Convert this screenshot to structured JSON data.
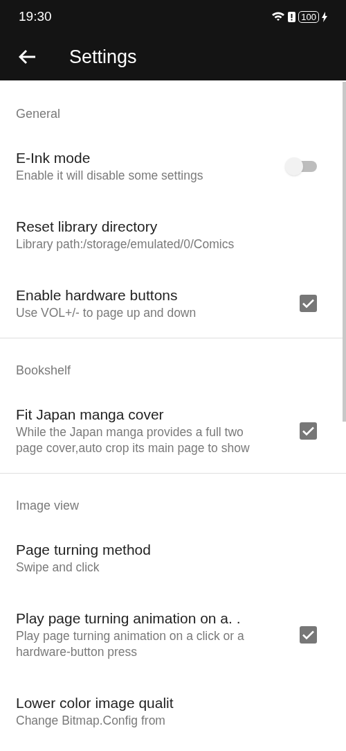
{
  "status_bar": {
    "time": "19:30",
    "battery": "100"
  },
  "toolbar": {
    "title": "Settings"
  },
  "sections": [
    {
      "title": "General",
      "items": [
        {
          "kind": "toggle",
          "title": "E-Ink mode",
          "subtitle": "Enable it will disable some settings",
          "on": false
        },
        {
          "kind": "plain",
          "title": "Reset library directory",
          "subtitle": "Library path:/storage/emulated/0/Comics"
        },
        {
          "kind": "checkbox",
          "title": "Enable hardware buttons",
          "subtitle": "Use VOL+/- to page up and down",
          "checked": true
        }
      ]
    },
    {
      "title": "Bookshelf",
      "items": [
        {
          "kind": "checkbox",
          "title": "Fit Japan manga cover",
          "subtitle": "While the Japan manga provides a full two page cover,auto crop its main page to show",
          "checked": true
        }
      ]
    },
    {
      "title": "Image view",
      "items": [
        {
          "kind": "plain",
          "title": "Page turning method",
          "subtitle": "Swipe and click"
        },
        {
          "kind": "checkbox",
          "title": "Play page turning animation on a. .",
          "subtitle": "Play page turning animation on a click or a hardware-button press",
          "checked": true
        },
        {
          "kind": "plain",
          "title": "Lower color image qualit",
          "subtitle": "Change Bitmap.Config from"
        }
      ]
    }
  ]
}
